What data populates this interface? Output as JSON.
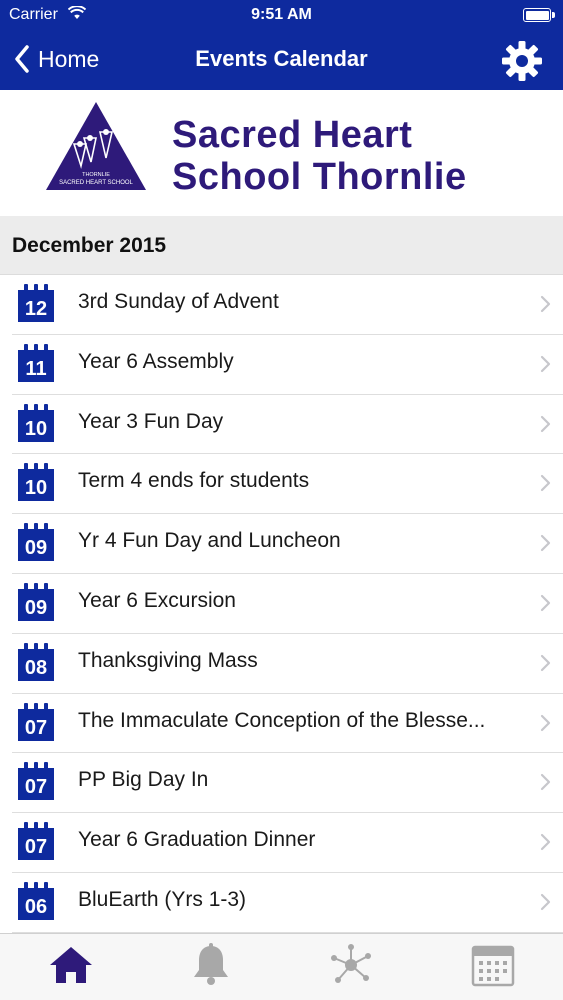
{
  "status_bar": {
    "carrier": "Carrier",
    "time": "9:51 AM",
    "wifi_icon": "wifi-icon",
    "battery_icon": "battery-icon"
  },
  "nav": {
    "back_label": "Home",
    "title": "Events Calendar",
    "settings_icon": "gear-icon"
  },
  "banner": {
    "school_name_line1": "Sacred Heart",
    "school_name_line2": "School Thornlie",
    "logo_text_top": "THORNLIE",
    "logo_text_bottom": "SACRED HEART SCHOOL"
  },
  "section": {
    "month": "December 2015"
  },
  "events": [
    {
      "day": "12",
      "title": "3rd Sunday of Advent"
    },
    {
      "day": "11",
      "title": "Year 6 Assembly"
    },
    {
      "day": "10",
      "title": "Year 3 Fun Day"
    },
    {
      "day": "10",
      "title": "Term 4 ends for students"
    },
    {
      "day": "09",
      "title": "Yr 4 Fun Day and Luncheon"
    },
    {
      "day": "09",
      "title": "Year 6 Excursion"
    },
    {
      "day": "08",
      "title": "Thanksgiving Mass"
    },
    {
      "day": "07",
      "title": "The Immaculate Conception of the Blesse..."
    },
    {
      "day": "07",
      "title": "PP Big Day In"
    },
    {
      "day": "07",
      "title": "Year 6 Graduation Dinner"
    },
    {
      "day": "06",
      "title": "BluEarth (Yrs 1-3)"
    }
  ],
  "tabs": [
    {
      "icon": "home-icon",
      "active": true
    },
    {
      "icon": "bell-icon",
      "active": false
    },
    {
      "icon": "network-icon",
      "active": false
    },
    {
      "icon": "calendar-icon",
      "active": false
    }
  ],
  "colors": {
    "brand_blue": "#0e2a9e",
    "school_purple": "#2e1a7a",
    "tab_inactive": "#a8a8a8",
    "chevron": "#c7c7cc"
  }
}
